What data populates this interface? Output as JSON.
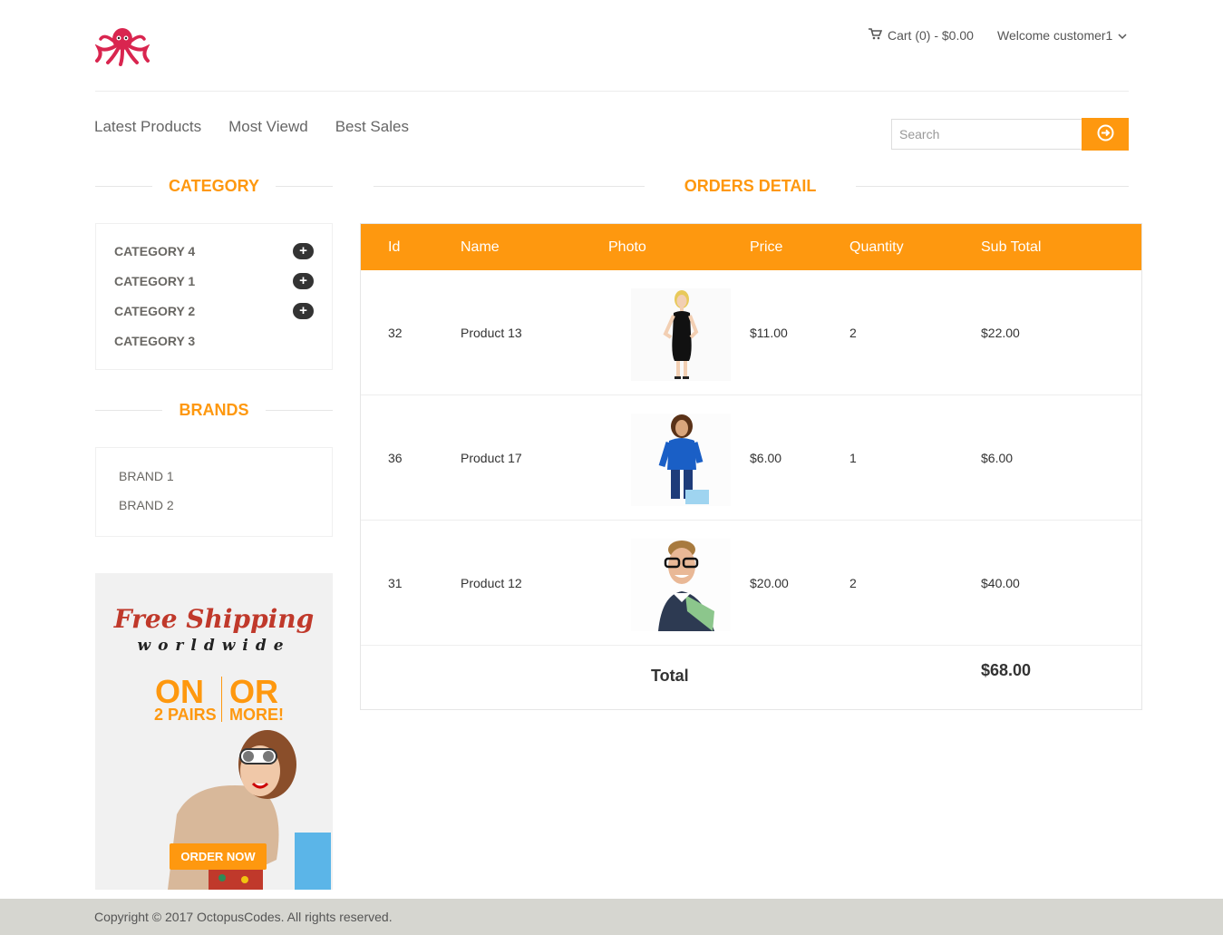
{
  "header": {
    "cart_text": "Cart (0) - $0.00",
    "welcome_text": "Welcome customer1"
  },
  "nav": [
    {
      "label": "Latest Products"
    },
    {
      "label": "Most Viewd"
    },
    {
      "label": "Best Sales"
    }
  ],
  "search": {
    "placeholder": "Search"
  },
  "sidebar": {
    "category_title": "CATEGORY",
    "categories": [
      {
        "label": "CATEGORY 4",
        "expandable": true
      },
      {
        "label": "CATEGORY 1",
        "expandable": true
      },
      {
        "label": "CATEGORY 2",
        "expandable": true
      },
      {
        "label": "CATEGORY 3",
        "expandable": false
      }
    ],
    "brands_title": "BRANDS",
    "brands": [
      {
        "label": "BRAND 1"
      },
      {
        "label": "BRAND 2"
      }
    ]
  },
  "ad": {
    "headline": "Free Shipping",
    "sub": "worldwide",
    "on": "ON",
    "or": "OR",
    "pairs": "2 PAIRS",
    "more": "MORE!",
    "cta": "ORDER NOW"
  },
  "orders": {
    "title": "ORDERS DETAIL",
    "columns": [
      "Id",
      "Name",
      "Photo",
      "Price",
      "Quantity",
      "Sub Total"
    ],
    "rows": [
      {
        "id": "32",
        "name": "Product 13",
        "price": "$11.00",
        "quantity": "2",
        "subtotal": "$22.00",
        "photo": "woman-black-dress"
      },
      {
        "id": "36",
        "name": "Product 17",
        "price": "$6.00",
        "quantity": "1",
        "subtotal": "$6.00",
        "photo": "woman-blue-top"
      },
      {
        "id": "31",
        "name": "Product 12",
        "price": "$20.00",
        "quantity": "2",
        "subtotal": "$40.00",
        "photo": "man-glasses"
      }
    ],
    "total_label": "Total",
    "total_value": "$68.00"
  },
  "footer": {
    "copyright": "Copyright © 2017 OctopusCodes. All rights reserved."
  },
  "colors": {
    "accent": "#fe980f",
    "footer_bg": "#d6d6d0",
    "logo": "#d9254f"
  }
}
